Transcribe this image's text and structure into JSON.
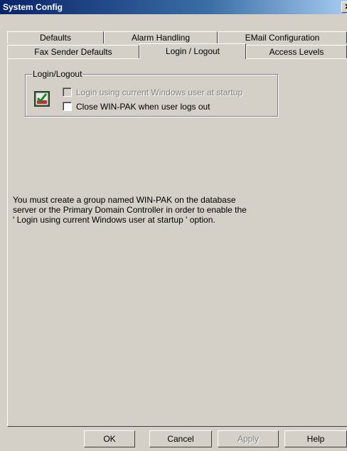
{
  "window": {
    "title": "System Config",
    "close_glyph": "✕"
  },
  "tabs": {
    "row1": [
      "Defaults",
      "Alarm Handling",
      "EMail Configuration"
    ],
    "row2": [
      "Fax Sender Defaults",
      "Login / Logout",
      "Access Levels"
    ],
    "active": "Login / Logout"
  },
  "group": {
    "legend": "Login/Logout",
    "options": [
      {
        "label": "Login using current Windows user at startup",
        "checked": false,
        "enabled": false
      },
      {
        "label": "Close WIN-PAK when user logs out",
        "checked": false,
        "enabled": true
      }
    ]
  },
  "note": {
    "lines": [
      "You must create a group named WIN-PAK on the database",
      "server or the Primary Domain Controller in order to enable the",
      "' Login using current Windows user at startup '  option."
    ]
  },
  "buttons": {
    "ok": "OK",
    "cancel": "Cancel",
    "apply": "Apply",
    "help": "Help"
  },
  "icons": {
    "app_icon": "checkmark-app-icon"
  }
}
